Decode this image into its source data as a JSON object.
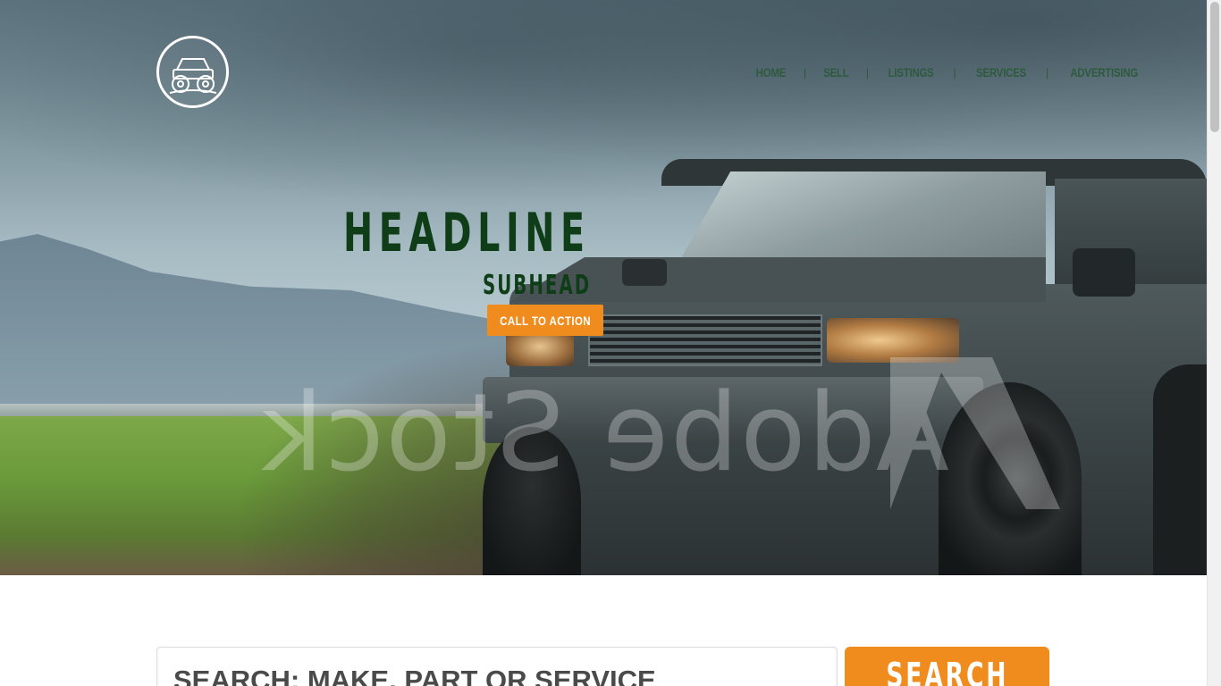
{
  "nav": {
    "items": [
      {
        "label": "HOME"
      },
      {
        "label": "SELL"
      },
      {
        "label": "LISTINGS"
      },
      {
        "label": "SERVICES"
      },
      {
        "label": "ADVERTISING"
      }
    ],
    "separator": "|"
  },
  "logo": {
    "icon": "offroad-truck-icon"
  },
  "hero": {
    "headline": "HEADLINE",
    "subhead": "SUBHEAD",
    "cta_label": "CALL TO ACTION",
    "watermark": "Adobe Stock"
  },
  "search": {
    "placeholder": "SEARCH: MAKE, PART OR SERVICE",
    "button_label": "SEARCH"
  },
  "colors": {
    "accent": "#f08b1d",
    "headline": "#0f3d17",
    "nav": "#2e5a3e"
  }
}
